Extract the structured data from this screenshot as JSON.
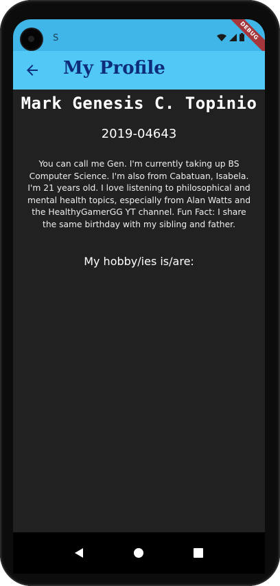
{
  "status_bar": {
    "indicator": "S",
    "debug_banner": "DEBUG",
    "icons": [
      "wifi-icon",
      "signal-icon",
      "battery-icon"
    ]
  },
  "app_bar": {
    "title": "My Profile",
    "back_icon": "arrow-back-icon"
  },
  "profile": {
    "name": "Mark Genesis C. Topinio",
    "student_id": "2019-04643",
    "bio": "You can call me Gen. I'm currently taking up BS Computer Science. I'm also from Cabatuan, Isabela. I'm 21 years old. I love listening to philosophical and mental health topics, especially from Alan Watts and the HealthyGamerGG YT channel. Fun Fact: I share the same birthday with my sibling and father.",
    "hobbies_label": "My hobby/ies is/are:"
  },
  "nav_bar": {
    "buttons": [
      "back-triangle-icon",
      "home-circle-icon",
      "recents-square-icon"
    ]
  },
  "colors": {
    "status_bar": "#3fb6e7",
    "app_bar": "#52c8f6",
    "title": "#0d2d7a",
    "background": "#212121",
    "debug": "#a5373c"
  }
}
